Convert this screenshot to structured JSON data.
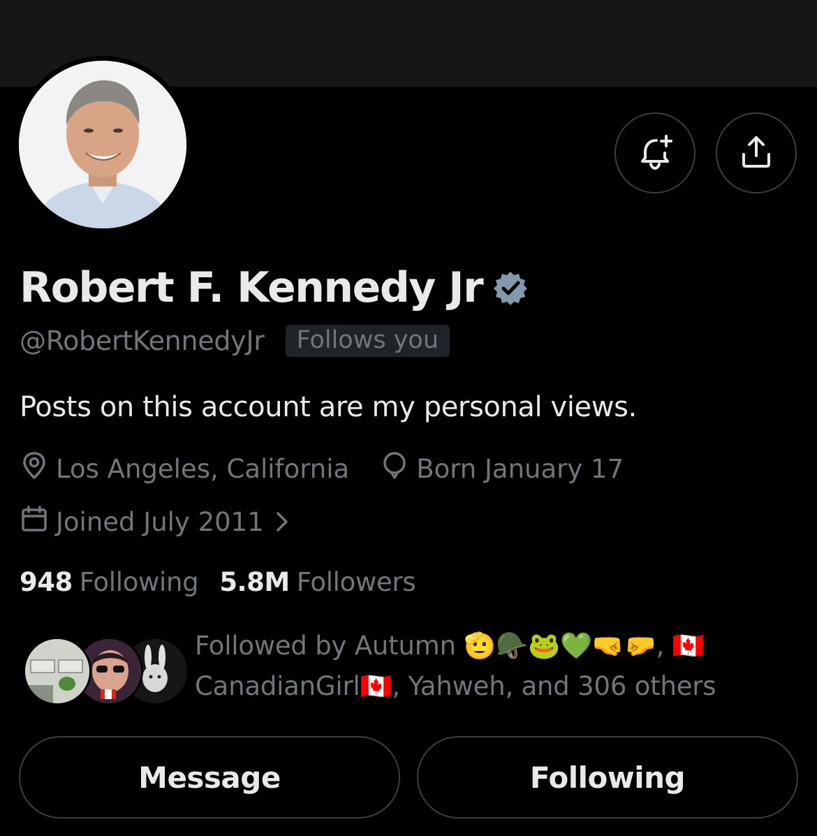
{
  "profile": {
    "name": "Robert F. Kennedy Jr",
    "handle": "@RobertKennedyJr",
    "follows_you_badge": "Follows you",
    "bio": "Posts on this account are my personal views.",
    "location": "Los Angeles, California",
    "birthday": "Born January 17",
    "joined": "Joined July 2011",
    "verified_color": "#829aab"
  },
  "stats": {
    "following_count": "948",
    "following_label": "Following",
    "followers_count": "5.8M",
    "followers_label": "Followers"
  },
  "followed_by": {
    "text": "Followed by Autumn 🫡🪖🐸💚🤜🤛, 🇨🇦 CanadianGirl🇨🇦, Yahweh, and 306 others"
  },
  "actions": {
    "message_label": "Message",
    "following_label": "Following"
  },
  "icons": {
    "notify": "bell-plus-icon",
    "share": "share-icon",
    "location": "location-pin-icon",
    "birthday": "balloon-icon",
    "joined": "calendar-icon",
    "chevron": "chevron-right-icon",
    "verified": "verified-badge-icon"
  }
}
